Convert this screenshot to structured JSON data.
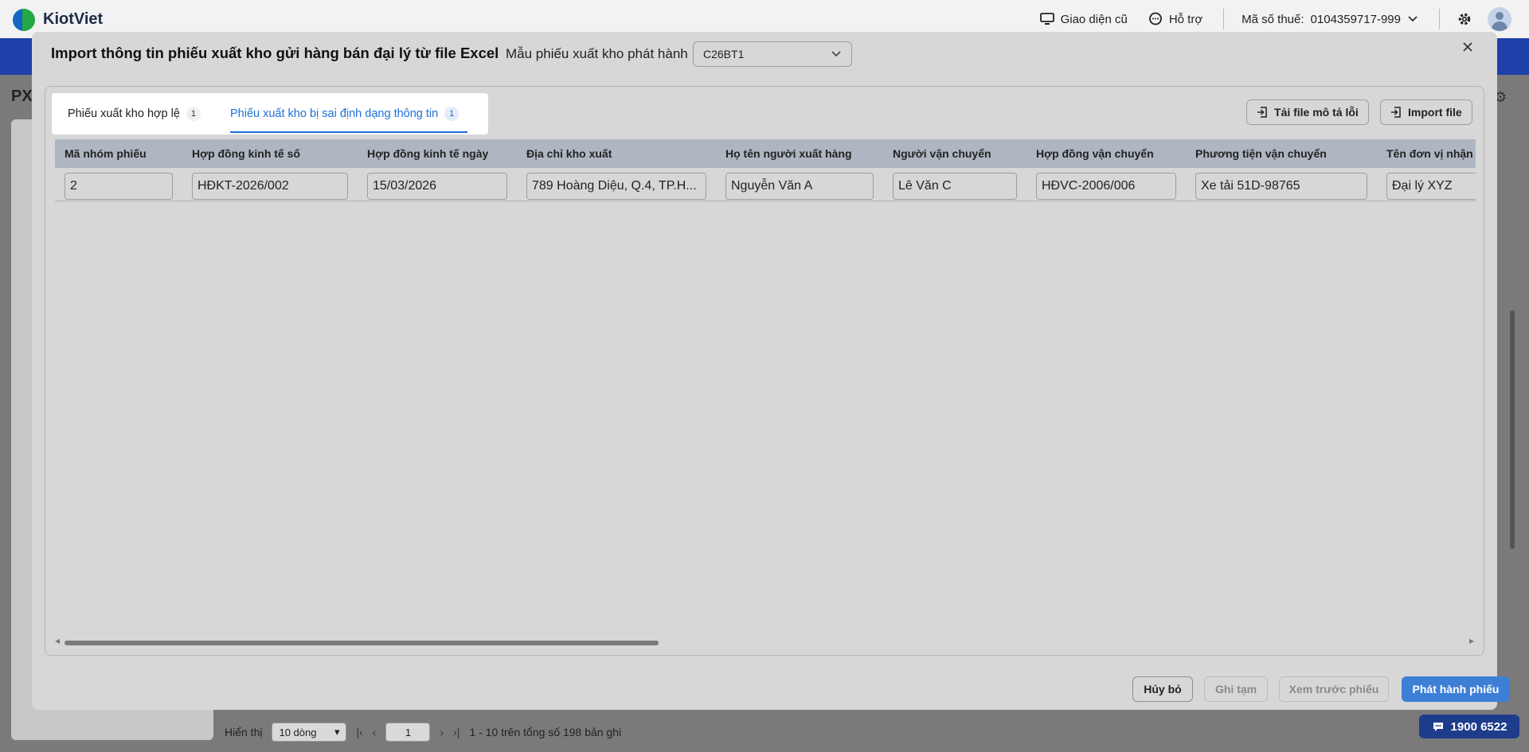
{
  "topbar": {
    "logo_text": "KiotViet",
    "classic_ui_label": "Giao diện cũ",
    "support_label": "Hỗ trợ",
    "tax_code_label": "Mã số thuế:",
    "tax_code_value": "0104359717-999"
  },
  "background": {
    "page_title": "PX",
    "pager": {
      "show_label": "Hiển thị",
      "page_size": "10 dòng",
      "current_page": "1",
      "range_text": "1 - 10 trên tổng số 198 bản ghi"
    },
    "hotline": "1900 6522"
  },
  "modal": {
    "title": "Import thông tin phiếu xuất kho gửi hàng bán đại lý từ file Excel",
    "template_label": "Mẫu phiếu xuất kho phát hành",
    "template_value": "C26BT1",
    "tabs": [
      {
        "label": "Phiếu xuất kho hợp lệ",
        "count": "1"
      },
      {
        "label": "Phiếu xuất kho bị sai định dạng thông tin",
        "count": "1"
      }
    ],
    "download_error_file_label": "Tải file mô tả lỗi",
    "import_file_label": "Import file",
    "columns": [
      "Mã nhóm phiếu",
      "Hợp đồng kinh tế số",
      "Hợp đồng kinh tế ngày",
      "Địa chỉ kho xuất",
      "Họ tên người xuất hàng",
      "Người vận chuyển",
      "Hợp đồng vận chuyển",
      "Phương tiện vận chuyển",
      "Tên đơn vị nhận"
    ],
    "rows": [
      [
        "2",
        "HĐKT-2026/002",
        "15/03/2026",
        "789 Hoàng Diệu, Q.4, TP.H...",
        "Nguyễn Văn A",
        "Lê Văn C",
        "HĐVC-2006/006",
        "Xe tải 51D-98765",
        "Đại lý XYZ"
      ]
    ],
    "footer": {
      "cancel": "Hủy bỏ",
      "save_draft": "Ghi tạm",
      "preview": "Xem trước phiếu",
      "publish": "Phát hành phiếu"
    }
  },
  "colors": {
    "brand_blue": "#1e40a8",
    "accent_blue": "#1e6fd9",
    "publish_button": "#3e7fd6",
    "table_header": "#aeb6c1"
  },
  "icons": [
    "monitor-icon",
    "chat-icon",
    "chevron-down-icon",
    "gear-icon",
    "user-avatar-icon",
    "close-icon",
    "file-import-icon"
  ]
}
